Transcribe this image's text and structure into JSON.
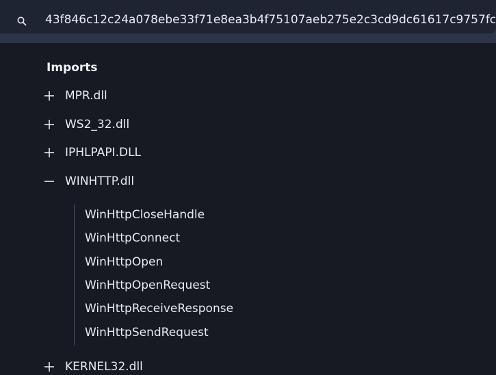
{
  "search": {
    "icon": "search-icon",
    "value": "43f846c12c24a078ebe33f71e8ea3b4f75107aeb275e2c3cd9dc61617c9757fc"
  },
  "imports": {
    "title": "Imports",
    "dlls": [
      {
        "name": "MPR.dll",
        "expanded": false
      },
      {
        "name": "WS2_32.dll",
        "expanded": false
      },
      {
        "name": "IPHLPAPI.DLL",
        "expanded": false
      },
      {
        "name": "WINHTTP.dll",
        "expanded": true,
        "functions": [
          "WinHttpCloseHandle",
          "WinHttpConnect",
          "WinHttpOpen",
          "WinHttpOpenRequest",
          "WinHttpReceiveResponse",
          "WinHttpSendRequest"
        ]
      },
      {
        "name": "KERNEL32.dll",
        "expanded": false
      }
    ]
  },
  "colors": {
    "background": "#171923",
    "search_bg": "#1f2433",
    "topbar_bg": "#2e3447",
    "text": "#e8eaf0",
    "tree_line": "#4a5266"
  }
}
